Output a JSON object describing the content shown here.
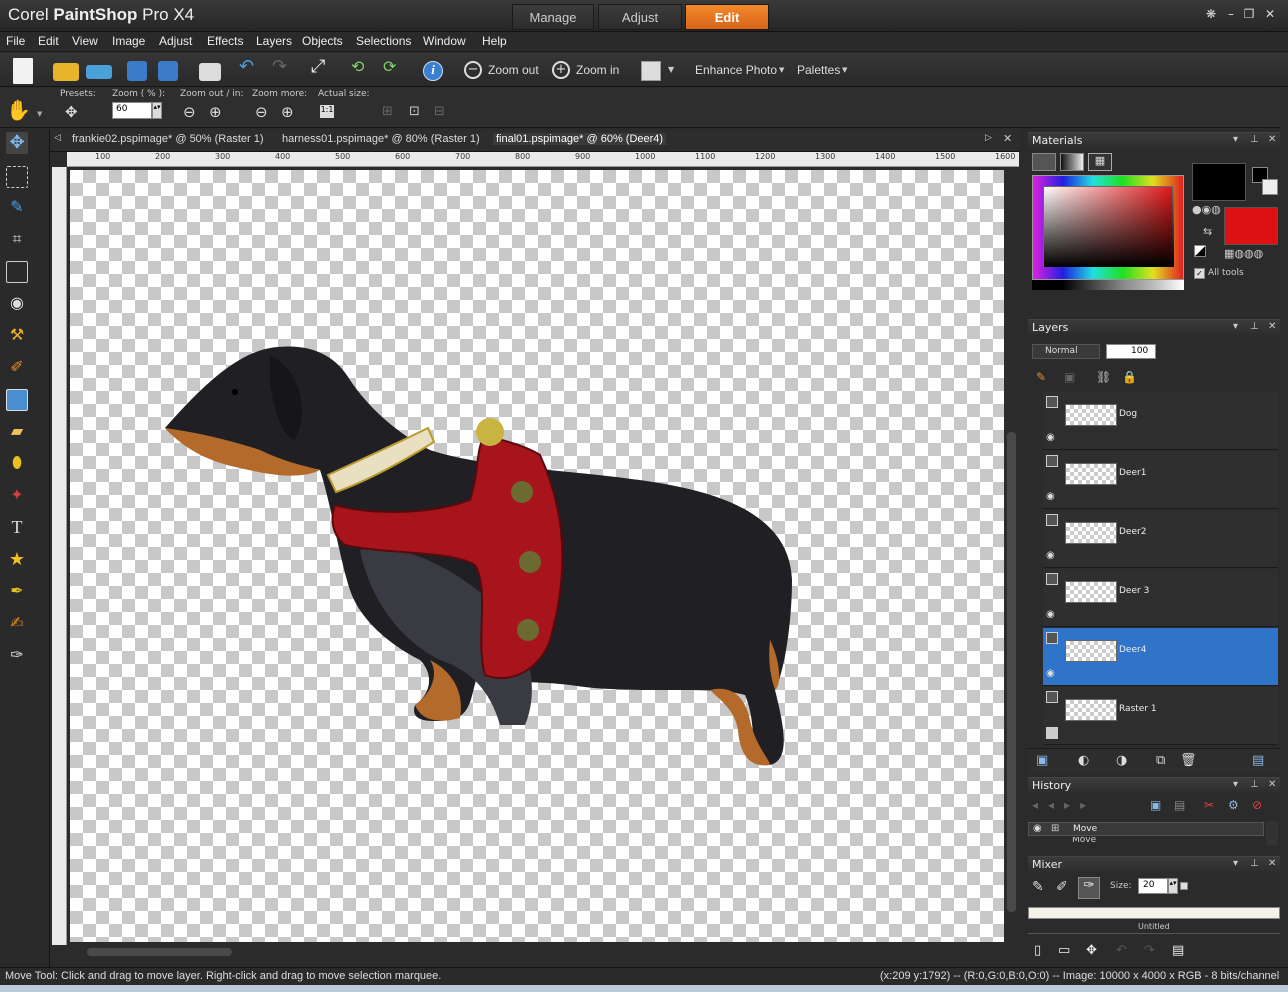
{
  "app": {
    "title_brand": "Corel",
    "title_product": "PaintShop",
    "title_version": "Pro X4"
  },
  "workspace_tabs": [
    "Manage",
    "Adjust",
    "Edit"
  ],
  "menu": [
    "File",
    "Edit",
    "View",
    "Image",
    "Adjust",
    "Effects",
    "Layers",
    "Objects",
    "Selections",
    "Window",
    "Help"
  ],
  "toolbar": {
    "zoom_out": "Zoom out",
    "zoom_in": "Zoom in",
    "enhance_photo": "Enhance Photo",
    "palettes": "Palettes"
  },
  "options": {
    "presets_label": "Presets:",
    "zoom_label": "Zoom ( % ):",
    "zoom_value": "60",
    "zoom_outin_label": "Zoom out / in:",
    "zoom_more_label": "Zoom more:",
    "actual_size_label": "Actual size:"
  },
  "doc_tabs": [
    "frankie02.pspimage* @  50% (Raster 1)",
    "harness01.pspimage* @  80% (Raster 1)",
    "final01.pspimage* @  60% (Deer4)"
  ],
  "ruler_ticks": [
    "100",
    "200",
    "300",
    "400",
    "500",
    "600",
    "700",
    "800",
    "900",
    "1000",
    "1100",
    "1200",
    "1300",
    "1400",
    "1500",
    "1600"
  ],
  "panels": {
    "materials": {
      "title": "Materials",
      "all_tools": "All tools",
      "fg_color": "#000000",
      "bg_color": "#dd1111"
    },
    "layers": {
      "title": "Layers",
      "blend_mode": "Normal",
      "opacity": "100",
      "items": [
        {
          "name": "Dog",
          "selected": false
        },
        {
          "name": "Deer1",
          "selected": false
        },
        {
          "name": "Deer2",
          "selected": false
        },
        {
          "name": "Deer 3",
          "selected": false
        },
        {
          "name": "Deer4",
          "selected": true
        },
        {
          "name": "Raster 1",
          "selected": false
        }
      ]
    },
    "history": {
      "title": "History",
      "items": [
        "Move",
        "Move"
      ]
    },
    "mixer": {
      "title": "Mixer",
      "size_label": "Size:",
      "size_value": "20",
      "untitled": "Untitled"
    }
  },
  "status": {
    "left": "Move Tool: Click and drag to move layer. Right-click and drag to move selection marquee.",
    "right": "(x:209 y:1792) -- (R:0,G:0,B:0,O:0) -- Image:  10000 x 4000 x RGB - 8 bits/channel"
  }
}
